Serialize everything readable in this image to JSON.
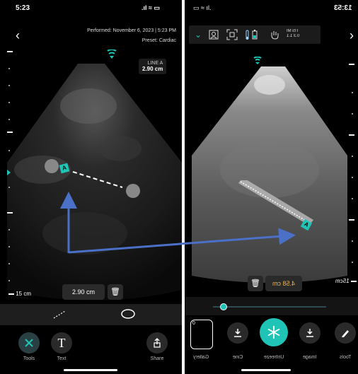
{
  "left": {
    "time": "5:23",
    "status_icons": ".ıl ≈ ▭",
    "performed": "Performed: November 6, 2023 | 5:23 PM",
    "preset": "Preset: Cardiac",
    "measure_label": "LINE A",
    "measure_value": "2.90 cm",
    "marker_letter": "A",
    "depth_label": "15 cm",
    "chip_value": "2.90 cm",
    "tabs": [
      {
        "label": "Tools",
        "icon": "close-icon"
      },
      {
        "label": "Text",
        "icon": "text-icon",
        "glyph": "T"
      },
      {
        "label": "Share",
        "icon": "share-icon"
      }
    ]
  },
  "right": {
    "time": "13:53",
    "measure_value": "4.58 cm",
    "marker_letter": "A",
    "depth_label": "15cm",
    "toolbar": [
      {
        "icon": "chevron-down-icon"
      },
      {
        "icon": "person-icon"
      },
      {
        "icon": "scan-icon"
      },
      {
        "icon": "thermometer-battery-icon"
      },
      {
        "icon": "hand-icon"
      },
      {
        "icon": "mi-tis-icon",
        "top": "MI",
        "bottom": "1.1",
        "top2": "TIS",
        "bottom2": "0.3"
      }
    ],
    "thumb_count": "0",
    "tabs": [
      {
        "label": "Gallery",
        "icon": "gallery-icon"
      },
      {
        "label": "Cine",
        "icon": "download-icon"
      },
      {
        "label": "Unfreeze",
        "icon": "snowflake-icon"
      },
      {
        "label": "Image",
        "icon": "download-icon"
      },
      {
        "label": "Tools",
        "icon": "pen-icon"
      }
    ]
  }
}
